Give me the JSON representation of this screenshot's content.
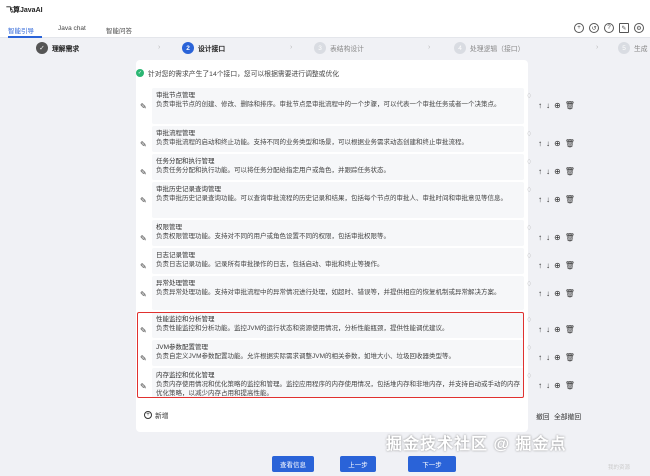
{
  "app": {
    "title": "飞算JavaAI"
  },
  "tabs": [
    {
      "label": "智能引导",
      "active": true
    },
    {
      "label": "Java chat",
      "active": false
    },
    {
      "label": "智能问答",
      "active": false
    }
  ],
  "top_icons": [
    "plus-circle-icon",
    "history-icon",
    "help-icon",
    "edit-icon",
    "settings-icon"
  ],
  "steps": [
    {
      "num": "✓",
      "label": "理解需求",
      "state": "done"
    },
    {
      "num": "2",
      "label": "设计接口",
      "state": "active"
    },
    {
      "num": "3",
      "label": "表结构设计",
      "state": "pending"
    },
    {
      "num": "4",
      "label": "处理逻辑（接口）",
      "state": "pending"
    },
    {
      "num": "5",
      "label": "生成",
      "state": "pending"
    }
  ],
  "notice": "针对您的需求产生了14个接口，您可以根据需要进行调整或优化",
  "items": [
    {
      "title": "审批节点管理",
      "desc": "负责审批节点的创建、修改、删除和排序。审批节点是审批流程中的一个步骤，可以代表一个审批任务或者一个决策点。"
    },
    {
      "title": "审批流程管理",
      "desc": "负责审批流程的启动和终止功能。支持不同的业务类型和场景，可以根据业务需求动态创建和终止审批流程。"
    },
    {
      "title": "任务分配和执行管理",
      "desc": "负责任务分配和执行功能。可以将任务分配给指定用户或角色，并跟踪任务状态。"
    },
    {
      "title": "审批历史记录查询管理",
      "desc": "负责审批历史记录查询功能。可以查询审批流程的历史记录和结果，包括每个节点的审批人、审批时间和审批意见等信息。"
    },
    {
      "title": "权限管理",
      "desc": "负责权限管理功能。支持对不同的用户或角色设置不同的权限，包括审批权限等。"
    },
    {
      "title": "日志记录管理",
      "desc": "负责日志记录功能。记录所有审批操作的日志，包括启动、审批和终止等操作。"
    },
    {
      "title": "异常处理管理",
      "desc": "负责异常处理功能。支持对审批流程中的异常情况进行处理，如超时、错误等，并提供相应的恢复机制或异常解决方案。"
    },
    {
      "title": "性能监控和分析管理",
      "desc": "负责性能监控和分析功能。监控JVM的运行状态和资源使用情况，分析性能瓶颈，提供性能调优建议。"
    },
    {
      "title": "JVM参数配置管理",
      "desc": "负责自定义JVM参数配置功能。允许根据实际需求调整JVM的相关参数，如堆大小、垃圾回收器类型等。"
    },
    {
      "title": "内存监控和优化管理",
      "desc": "负责内存使用情况和优化策略的监控和管理。监控应用程序的内存使用情况，包括堆内存和非堆内存，并支持自动或手动的内存优化策略，以减少内存占用和提高性能。"
    }
  ],
  "add_label": "新增",
  "undo_label": "撤回",
  "undo_all_label": "全部撤回",
  "buttons": {
    "view_info": "查看信息",
    "prev": "上一步",
    "next": "下一步"
  },
  "watermark": "掘金技术社区 @ 掘金点",
  "watermark_small": "我的资源",
  "colors": {
    "accent": "#2a63d8",
    "highlight": "#e0312f",
    "success": "#2bb673"
  }
}
